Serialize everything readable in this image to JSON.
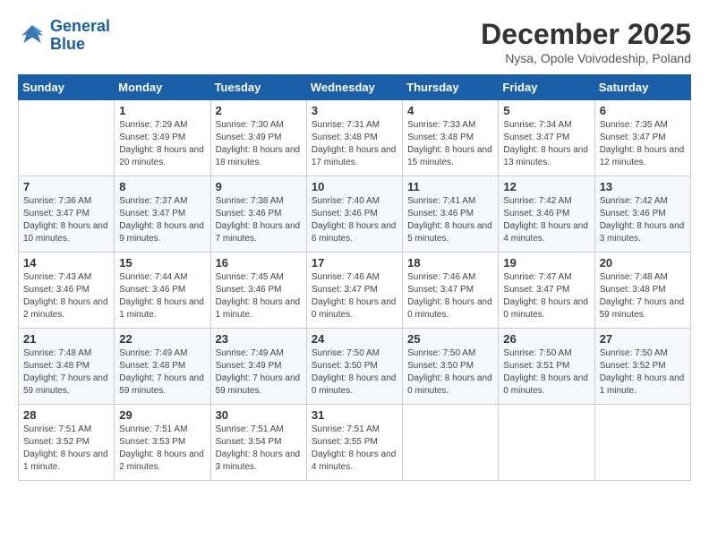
{
  "header": {
    "logo_line1": "General",
    "logo_line2": "Blue",
    "month": "December 2025",
    "location": "Nysa, Opole Voivodeship, Poland"
  },
  "days_of_week": [
    "Sunday",
    "Monday",
    "Tuesday",
    "Wednesday",
    "Thursday",
    "Friday",
    "Saturday"
  ],
  "weeks": [
    [
      {
        "day": "",
        "sunrise": "",
        "sunset": "",
        "daylight": ""
      },
      {
        "day": "1",
        "sunrise": "Sunrise: 7:29 AM",
        "sunset": "Sunset: 3:49 PM",
        "daylight": "Daylight: 8 hours and 20 minutes."
      },
      {
        "day": "2",
        "sunrise": "Sunrise: 7:30 AM",
        "sunset": "Sunset: 3:49 PM",
        "daylight": "Daylight: 8 hours and 18 minutes."
      },
      {
        "day": "3",
        "sunrise": "Sunrise: 7:31 AM",
        "sunset": "Sunset: 3:48 PM",
        "daylight": "Daylight: 8 hours and 17 minutes."
      },
      {
        "day": "4",
        "sunrise": "Sunrise: 7:33 AM",
        "sunset": "Sunset: 3:48 PM",
        "daylight": "Daylight: 8 hours and 15 minutes."
      },
      {
        "day": "5",
        "sunrise": "Sunrise: 7:34 AM",
        "sunset": "Sunset: 3:47 PM",
        "daylight": "Daylight: 8 hours and 13 minutes."
      },
      {
        "day": "6",
        "sunrise": "Sunrise: 7:35 AM",
        "sunset": "Sunset: 3:47 PM",
        "daylight": "Daylight: 8 hours and 12 minutes."
      }
    ],
    [
      {
        "day": "7",
        "sunrise": "Sunrise: 7:36 AM",
        "sunset": "Sunset: 3:47 PM",
        "daylight": "Daylight: 8 hours and 10 minutes."
      },
      {
        "day": "8",
        "sunrise": "Sunrise: 7:37 AM",
        "sunset": "Sunset: 3:47 PM",
        "daylight": "Daylight: 8 hours and 9 minutes."
      },
      {
        "day": "9",
        "sunrise": "Sunrise: 7:38 AM",
        "sunset": "Sunset: 3:46 PM",
        "daylight": "Daylight: 8 hours and 7 minutes."
      },
      {
        "day": "10",
        "sunrise": "Sunrise: 7:40 AM",
        "sunset": "Sunset: 3:46 PM",
        "daylight": "Daylight: 8 hours and 6 minutes."
      },
      {
        "day": "11",
        "sunrise": "Sunrise: 7:41 AM",
        "sunset": "Sunset: 3:46 PM",
        "daylight": "Daylight: 8 hours and 5 minutes."
      },
      {
        "day": "12",
        "sunrise": "Sunrise: 7:42 AM",
        "sunset": "Sunset: 3:46 PM",
        "daylight": "Daylight: 8 hours and 4 minutes."
      },
      {
        "day": "13",
        "sunrise": "Sunrise: 7:42 AM",
        "sunset": "Sunset: 3:46 PM",
        "daylight": "Daylight: 8 hours and 3 minutes."
      }
    ],
    [
      {
        "day": "14",
        "sunrise": "Sunrise: 7:43 AM",
        "sunset": "Sunset: 3:46 PM",
        "daylight": "Daylight: 8 hours and 2 minutes."
      },
      {
        "day": "15",
        "sunrise": "Sunrise: 7:44 AM",
        "sunset": "Sunset: 3:46 PM",
        "daylight": "Daylight: 8 hours and 1 minute."
      },
      {
        "day": "16",
        "sunrise": "Sunrise: 7:45 AM",
        "sunset": "Sunset: 3:46 PM",
        "daylight": "Daylight: 8 hours and 1 minute."
      },
      {
        "day": "17",
        "sunrise": "Sunrise: 7:46 AM",
        "sunset": "Sunset: 3:47 PM",
        "daylight": "Daylight: 8 hours and 0 minutes."
      },
      {
        "day": "18",
        "sunrise": "Sunrise: 7:46 AM",
        "sunset": "Sunset: 3:47 PM",
        "daylight": "Daylight: 8 hours and 0 minutes."
      },
      {
        "day": "19",
        "sunrise": "Sunrise: 7:47 AM",
        "sunset": "Sunset: 3:47 PM",
        "daylight": "Daylight: 8 hours and 0 minutes."
      },
      {
        "day": "20",
        "sunrise": "Sunrise: 7:48 AM",
        "sunset": "Sunset: 3:48 PM",
        "daylight": "Daylight: 7 hours and 59 minutes."
      }
    ],
    [
      {
        "day": "21",
        "sunrise": "Sunrise: 7:48 AM",
        "sunset": "Sunset: 3:48 PM",
        "daylight": "Daylight: 7 hours and 59 minutes."
      },
      {
        "day": "22",
        "sunrise": "Sunrise: 7:49 AM",
        "sunset": "Sunset: 3:48 PM",
        "daylight": "Daylight: 7 hours and 59 minutes."
      },
      {
        "day": "23",
        "sunrise": "Sunrise: 7:49 AM",
        "sunset": "Sunset: 3:49 PM",
        "daylight": "Daylight: 7 hours and 59 minutes."
      },
      {
        "day": "24",
        "sunrise": "Sunrise: 7:50 AM",
        "sunset": "Sunset: 3:50 PM",
        "daylight": "Daylight: 8 hours and 0 minutes."
      },
      {
        "day": "25",
        "sunrise": "Sunrise: 7:50 AM",
        "sunset": "Sunset: 3:50 PM",
        "daylight": "Daylight: 8 hours and 0 minutes."
      },
      {
        "day": "26",
        "sunrise": "Sunrise: 7:50 AM",
        "sunset": "Sunset: 3:51 PM",
        "daylight": "Daylight: 8 hours and 0 minutes."
      },
      {
        "day": "27",
        "sunrise": "Sunrise: 7:50 AM",
        "sunset": "Sunset: 3:52 PM",
        "daylight": "Daylight: 8 hours and 1 minute."
      }
    ],
    [
      {
        "day": "28",
        "sunrise": "Sunrise: 7:51 AM",
        "sunset": "Sunset: 3:52 PM",
        "daylight": "Daylight: 8 hours and 1 minute."
      },
      {
        "day": "29",
        "sunrise": "Sunrise: 7:51 AM",
        "sunset": "Sunset: 3:53 PM",
        "daylight": "Daylight: 8 hours and 2 minutes."
      },
      {
        "day": "30",
        "sunrise": "Sunrise: 7:51 AM",
        "sunset": "Sunset: 3:54 PM",
        "daylight": "Daylight: 8 hours and 3 minutes."
      },
      {
        "day": "31",
        "sunrise": "Sunrise: 7:51 AM",
        "sunset": "Sunset: 3:55 PM",
        "daylight": "Daylight: 8 hours and 4 minutes."
      },
      {
        "day": "",
        "sunrise": "",
        "sunset": "",
        "daylight": ""
      },
      {
        "day": "",
        "sunrise": "",
        "sunset": "",
        "daylight": ""
      },
      {
        "day": "",
        "sunrise": "",
        "sunset": "",
        "daylight": ""
      }
    ]
  ]
}
